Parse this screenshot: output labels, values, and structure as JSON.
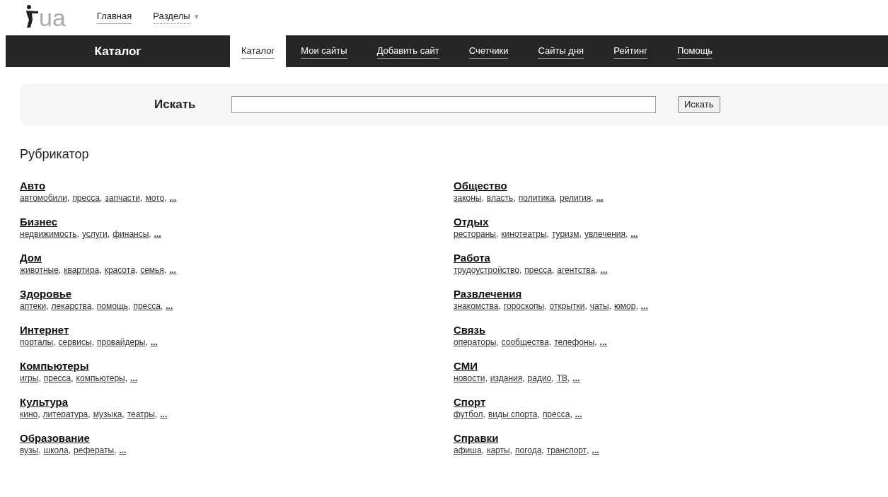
{
  "logo": {
    "text": "ua"
  },
  "top_links": [
    {
      "label": "Главная",
      "kind": "link"
    },
    {
      "label": "Разделы",
      "kind": "dropdown",
      "caret": "▼"
    }
  ],
  "header": {
    "title": "Каталог"
  },
  "tabs": [
    {
      "label": "Каталог",
      "selected": true
    },
    {
      "label": "Мои сайты",
      "selected": false
    },
    {
      "label": "Добавить сайт",
      "selected": false
    },
    {
      "label": "Счетчики",
      "selected": false
    },
    {
      "label": "Сайты дня",
      "selected": false
    },
    {
      "label": "Рейтинг",
      "selected": false
    },
    {
      "label": "Помощь",
      "selected": false
    }
  ],
  "search": {
    "label": "Искать",
    "button": "Искать"
  },
  "rubricator": {
    "title": "Рубрикатор",
    "columns": [
      [
        {
          "title": "Авто",
          "links": [
            {
              "label": "автомобили",
              "separator": ","
            },
            {
              "label": "пресса",
              "separator": ","
            },
            {
              "label": "запчасти",
              "separator": ","
            },
            {
              "label": "мото",
              "separator": ","
            }
          ],
          "more": "..."
        },
        {
          "title": "Бизнес",
          "links": [
            {
              "label": "недвижимость",
              "separator": ","
            },
            {
              "label": "услуги",
              "separator": ","
            },
            {
              "label": "финансы",
              "separator": ","
            }
          ],
          "more": "..."
        },
        {
          "title": "Дом",
          "links": [
            {
              "label": "животные",
              "separator": ","
            },
            {
              "label": "квартира",
              "separator": ","
            },
            {
              "label": "красота",
              "separator": ","
            },
            {
              "label": "семья",
              "separator": ","
            }
          ],
          "more": "..."
        },
        {
          "title": "Здоровье",
          "links": [
            {
              "label": "аптеки",
              "separator": ","
            },
            {
              "label": "лекарства",
              "separator": ","
            },
            {
              "label": "помощь",
              "separator": ","
            },
            {
              "label": "пресса",
              "separator": ","
            }
          ],
          "more": "..."
        },
        {
          "title": "Интернет",
          "links": [
            {
              "label": "порталы",
              "separator": ","
            },
            {
              "label": "сервисы",
              "separator": ","
            },
            {
              "label": "провайдеры",
              "separator": ","
            }
          ],
          "more": "..."
        },
        {
          "title": "Компьютеры",
          "links": [
            {
              "label": "игры",
              "separator": ","
            },
            {
              "label": "пресса",
              "separator": ","
            },
            {
              "label": "компьютеры",
              "separator": ","
            }
          ],
          "more": "..."
        },
        {
          "title": "Культура",
          "links": [
            {
              "label": "кино",
              "separator": ","
            },
            {
              "label": "литература",
              "separator": ","
            },
            {
              "label": "музыка",
              "separator": ","
            },
            {
              "label": "театры",
              "separator": ","
            }
          ],
          "more": "..."
        },
        {
          "title": "Образование",
          "links": [
            {
              "label": "вузы",
              "separator": ","
            },
            {
              "label": "школа",
              "separator": ","
            },
            {
              "label": "рефераты",
              "separator": ","
            }
          ],
          "more": "..."
        }
      ],
      [
        {
          "title": "Общество",
          "links": [
            {
              "label": "законы",
              "separator": ","
            },
            {
              "label": "власть",
              "separator": ","
            },
            {
              "label": "политика",
              "separator": ","
            },
            {
              "label": "религия",
              "separator": ","
            }
          ],
          "more": "..."
        },
        {
          "title": "Отдых",
          "links": [
            {
              "label": "рестораны",
              "separator": ","
            },
            {
              "label": "кинотеатры",
              "separator": ","
            },
            {
              "label": "туризм",
              "separator": ","
            },
            {
              "label": "увлечения",
              "separator": ","
            }
          ],
          "more": "..."
        },
        {
          "title": "Работа",
          "links": [
            {
              "label": "трудоустройство",
              "separator": ","
            },
            {
              "label": "пресса",
              "separator": ","
            },
            {
              "label": "агентства",
              "separator": ","
            }
          ],
          "more": "..."
        },
        {
          "title": "Развлечения",
          "links": [
            {
              "label": "знакомства",
              "separator": ","
            },
            {
              "label": "гороскопы",
              "separator": ","
            },
            {
              "label": "открытки",
              "separator": ","
            },
            {
              "label": "чаты",
              "separator": ","
            },
            {
              "label": "юмор",
              "separator": ","
            }
          ],
          "more": "..."
        },
        {
          "title": "Связь",
          "links": [
            {
              "label": "операторы",
              "separator": ","
            },
            {
              "label": "сообщества",
              "separator": ","
            },
            {
              "label": "телефоны",
              "separator": ","
            }
          ],
          "more": "..."
        },
        {
          "title": "СМИ",
          "links": [
            {
              "label": "новости",
              "separator": ","
            },
            {
              "label": "издания",
              "separator": ","
            },
            {
              "label": "радио",
              "separator": ","
            },
            {
              "label": "ТВ",
              "separator": ","
            }
          ],
          "more": "..."
        },
        {
          "title": "Спорт",
          "links": [
            {
              "label": "футбол",
              "separator": ","
            },
            {
              "label": "виды спорта",
              "separator": ","
            },
            {
              "label": "пресса",
              "separator": ","
            }
          ],
          "more": "..."
        },
        {
          "title": "Справки",
          "links": [
            {
              "label": "афиша",
              "separator": ","
            },
            {
              "label": "карты",
              "separator": ","
            },
            {
              "label": "погода",
              "separator": ","
            },
            {
              "label": "транспорт",
              "separator": ","
            }
          ],
          "more": "..."
        }
      ]
    ]
  }
}
